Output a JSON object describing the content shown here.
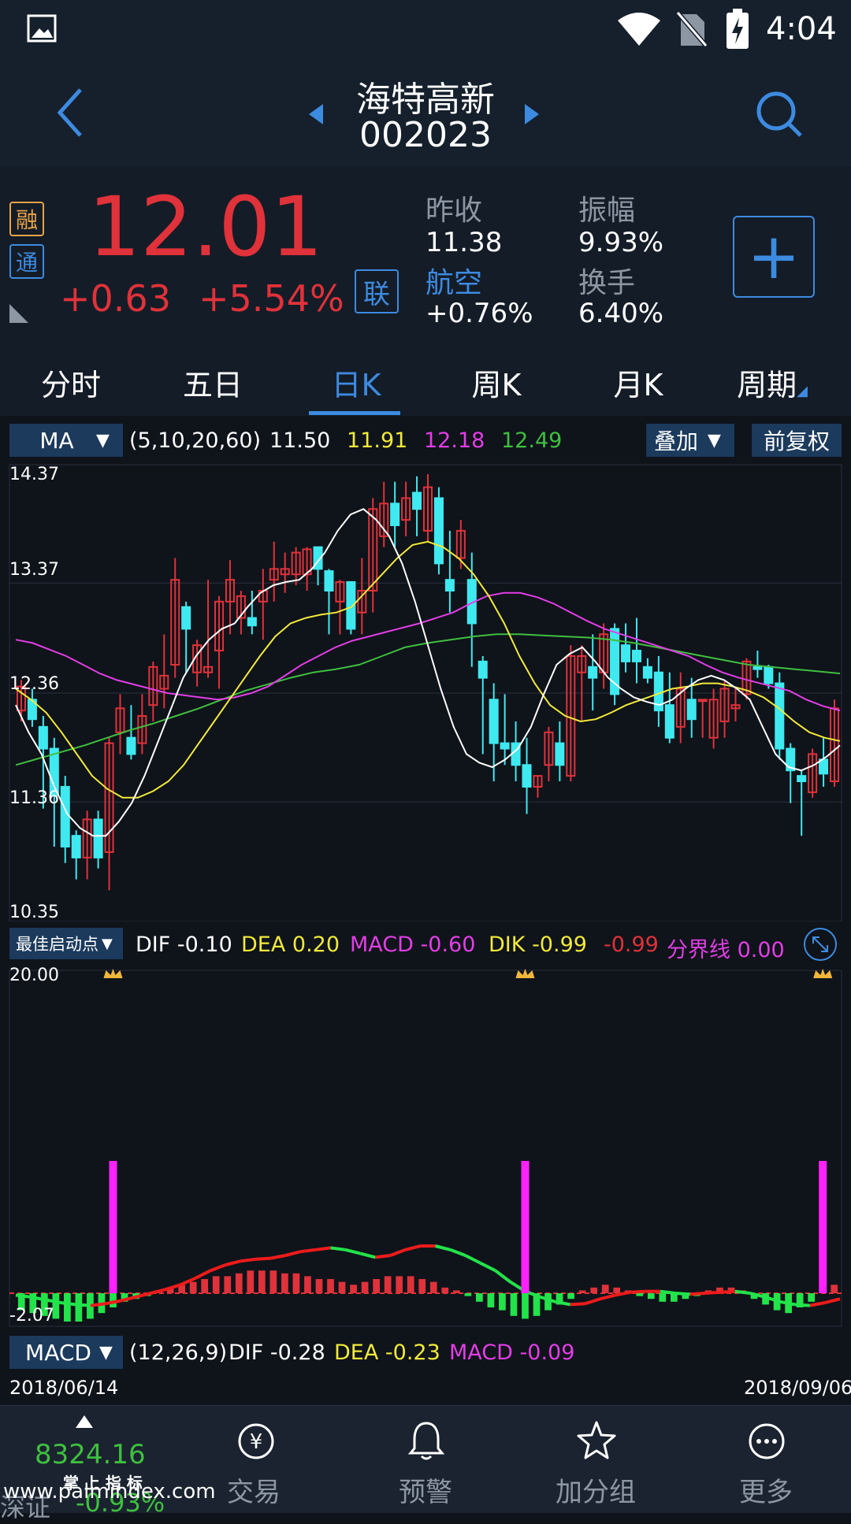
{
  "status": {
    "time": "4:04"
  },
  "header": {
    "name": "海特高新",
    "code": "002023"
  },
  "quote": {
    "badges": [
      "融",
      "通"
    ],
    "price": "12.01",
    "change": "+0.63",
    "change_pct": "+5.54%",
    "lian": "联",
    "prev_close_label": "昨收",
    "prev_close": "11.38",
    "amplitude_label": "振幅",
    "amplitude": "9.93%",
    "sector_label": "航空",
    "sector_change": "+0.76%",
    "turnover_label": "换手",
    "turnover": "6.40%",
    "plus": "+"
  },
  "tabs": [
    "分时",
    "五日",
    "日K",
    "周K",
    "月K",
    "周期"
  ],
  "active_tab": 2,
  "ma_bar": {
    "selector": "MA",
    "params": "(5,10,20,60)",
    "ma5": "11.50",
    "ma10": "11.91",
    "ma20": "12.18",
    "ma60": "12.49",
    "overlay": "叠加",
    "adjust": "前复权"
  },
  "price_axis": [
    "14.37",
    "13.37",
    "12.36",
    "11.36",
    "10.35"
  ],
  "ind_bar": {
    "selector": "最佳启动点",
    "dif_label": "DIF",
    "dif": "-0.10",
    "dea_label": "DEA",
    "dea": "0.20",
    "macd_label": "MACD",
    "macd": "-0.60",
    "dik_label": "DIK",
    "dik": "-0.99",
    "extra": "-0.99",
    "boundary_label": "分界线",
    "boundary": "0.00"
  },
  "ind_axis": {
    "top": "20.00",
    "bottom": "-2.07"
  },
  "macd_bar": {
    "selector": "MACD",
    "params": "(12,26,9)",
    "dif_label": "DIF",
    "dif": "-0.28",
    "dea_label": "DEA",
    "dea": "-0.23",
    "macd_label": "MACD",
    "macd": "-0.09"
  },
  "dates": {
    "start": "2018/06/14",
    "end": "2018/09/06"
  },
  "nav": {
    "index_value": "8324.16",
    "index_tag": "掌 上 指 标",
    "index_name": "深证",
    "index_change": "-0.93%",
    "items": [
      "交易",
      "预警",
      "加分组",
      "更多"
    ]
  },
  "watermark": "www.palmindex.com",
  "colors": {
    "up": "#e0323a",
    "down": "#3fe9f0",
    "ma5": "#ffffff",
    "ma10": "#f2ea3a",
    "ma20": "#e23ee6",
    "ma60": "#3fbf3f",
    "accent": "#3d8be0"
  },
  "chart_data": {
    "type": "candlestick",
    "ylim": [
      10.35,
      14.37
    ],
    "candles": [
      [
        12.2,
        12.42,
        12.1,
        12.48
      ],
      [
        12.3,
        12.12,
        12.05,
        12.4
      ],
      [
        12.05,
        11.85,
        11.3,
        12.15
      ],
      [
        11.85,
        11.42,
        10.95,
        11.95
      ],
      [
        11.5,
        10.95,
        10.8,
        11.6
      ],
      [
        11.05,
        10.85,
        10.65,
        11.1
      ],
      [
        10.85,
        11.2,
        10.65,
        11.28
      ],
      [
        11.2,
        10.85,
        10.75,
        11.28
      ],
      [
        10.9,
        11.9,
        10.55,
        11.95
      ],
      [
        12.0,
        12.22,
        11.8,
        12.35
      ],
      [
        11.95,
        11.8,
        11.75,
        12.25
      ],
      [
        11.9,
        12.15,
        11.8,
        12.35
      ],
      [
        12.25,
        12.6,
        12.1,
        12.65
      ],
      [
        12.4,
        12.52,
        12.22,
        12.9
      ],
      [
        12.62,
        13.4,
        12.5,
        13.6
      ],
      [
        13.15,
        12.95,
        12.55,
        13.2
      ],
      [
        12.55,
        12.8,
        12.42,
        12.85
      ],
      [
        12.55,
        12.6,
        12.5,
        13.4
      ],
      [
        12.75,
        13.2,
        12.4,
        13.25
      ],
      [
        13.2,
        13.4,
        12.9,
        13.58
      ],
      [
        13.05,
        13.25,
        12.9,
        13.3
      ],
      [
        13.05,
        12.98,
        12.9,
        13.3
      ],
      [
        13.2,
        13.3,
        12.85,
        13.5
      ],
      [
        13.4,
        13.5,
        13.2,
        13.75
      ],
      [
        13.45,
        13.5,
        13.28,
        13.65
      ],
      [
        13.45,
        13.65,
        13.35,
        13.7
      ],
      [
        13.45,
        13.68,
        13.3,
        13.7
      ],
      [
        13.7,
        13.5,
        13.35,
        13.7
      ],
      [
        13.48,
        13.3,
        12.9,
        13.5
      ],
      [
        13.2,
        13.38,
        12.9,
        13.4
      ],
      [
        13.38,
        12.95,
        12.9,
        13.38
      ],
      [
        13.1,
        13.3,
        12.9,
        13.6
      ],
      [
        13.3,
        14.05,
        13.1,
        14.15
      ],
      [
        13.8,
        14.1,
        13.7,
        14.3
      ],
      [
        14.1,
        13.9,
        13.7,
        14.3
      ],
      [
        13.95,
        14.15,
        13.8,
        14.3
      ],
      [
        14.2,
        14.05,
        13.8,
        14.35
      ],
      [
        13.85,
        14.25,
        13.75,
        14.37
      ],
      [
        14.15,
        13.55,
        13.45,
        14.25
      ],
      [
        13.4,
        13.3,
        13.1,
        13.85
      ],
      [
        13.6,
        13.85,
        13.5,
        13.95
      ],
      [
        13.4,
        13.0,
        12.6,
        13.65
      ],
      [
        12.65,
        12.5,
        11.8,
        12.7
      ],
      [
        12.3,
        11.9,
        11.55,
        12.45
      ],
      [
        11.9,
        11.85,
        11.7,
        12.35
      ],
      [
        11.9,
        11.7,
        11.55,
        12.1
      ],
      [
        11.7,
        11.5,
        11.25,
        11.95
      ],
      [
        11.5,
        11.6,
        11.4,
        11.6
      ],
      [
        11.7,
        12.0,
        11.55,
        12.05
      ],
      [
        11.9,
        11.7,
        11.55,
        12.1
      ],
      [
        11.6,
        12.7,
        11.55,
        12.8
      ],
      [
        12.55,
        12.7,
        12.1,
        12.8
      ],
      [
        12.6,
        12.5,
        12.2,
        12.9
      ],
      [
        12.55,
        12.9,
        12.4,
        13.0
      ],
      [
        12.95,
        12.35,
        12.25,
        13.0
      ],
      [
        12.8,
        12.65,
        12.55,
        13.0
      ],
      [
        12.75,
        12.65,
        12.45,
        13.05
      ],
      [
        12.6,
        12.5,
        12.45,
        12.68
      ],
      [
        12.55,
        12.2,
        12.05,
        12.7
      ],
      [
        12.25,
        11.95,
        11.9,
        12.55
      ],
      [
        12.05,
        12.4,
        11.9,
        12.55
      ],
      [
        12.3,
        12.12,
        11.95,
        12.5
      ],
      [
        12.3,
        12.3,
        11.95,
        12.3
      ],
      [
        11.95,
        12.3,
        11.85,
        12.4
      ],
      [
        12.1,
        12.4,
        11.95,
        12.48
      ],
      [
        12.22,
        12.25,
        12.1,
        12.4
      ],
      [
        12.35,
        12.65,
        12.3,
        12.68
      ],
      [
        12.6,
        12.58,
        12.5,
        12.75
      ],
      [
        12.6,
        12.45,
        12.4,
        12.62
      ],
      [
        12.45,
        11.85,
        11.75,
        12.55
      ],
      [
        11.85,
        11.65,
        11.35,
        11.9
      ],
      [
        11.6,
        11.55,
        11.05,
        11.65
      ],
      [
        11.45,
        11.8,
        11.4,
        11.85
      ],
      [
        11.75,
        11.62,
        11.5,
        11.95
      ],
      [
        11.55,
        12.22,
        11.5,
        12.3
      ]
    ],
    "ma_series": {
      "ma5": [
        12.25,
        12.0,
        11.8,
        11.5,
        11.25,
        11.12,
        11.05,
        11.05,
        11.18,
        11.35,
        11.6,
        11.9,
        12.2,
        12.5,
        12.7,
        12.85,
        12.95,
        13.0,
        13.15,
        13.28,
        13.35,
        13.38,
        13.4,
        13.5,
        13.65,
        13.85,
        14.0,
        14.05,
        13.95,
        13.8,
        13.55,
        13.2,
        12.8,
        12.4,
        12.05,
        11.8,
        11.72,
        11.68,
        11.75,
        11.85,
        12.05,
        12.35,
        12.62,
        12.72,
        12.78,
        12.65,
        12.5,
        12.4,
        12.32,
        12.28,
        12.25,
        12.3,
        12.4,
        12.48,
        12.52,
        12.48,
        12.4,
        12.3,
        12.05,
        11.8,
        11.68,
        11.65,
        11.7,
        11.78,
        11.88
      ],
      "ma10": [
        12.4,
        12.3,
        12.18,
        12.0,
        11.8,
        11.6,
        11.48,
        11.4,
        11.4,
        11.46,
        11.55,
        11.7,
        11.9,
        12.1,
        12.3,
        12.5,
        12.7,
        12.88,
        13.0,
        13.05,
        13.08,
        13.1,
        13.15,
        13.3,
        13.45,
        13.6,
        13.72,
        13.75,
        13.7,
        13.6,
        13.45,
        13.25,
        13.0,
        12.7,
        12.45,
        12.25,
        12.15,
        12.1,
        12.12,
        12.18,
        12.25,
        12.3,
        12.35,
        12.4,
        12.42,
        12.45,
        12.45,
        12.42,
        12.38,
        12.32,
        12.22,
        12.1,
        12.0,
        11.95,
        11.92
      ],
      "ma20": [
        12.85,
        12.82,
        12.76,
        12.7,
        12.62,
        12.54,
        12.48,
        12.44,
        12.4,
        12.36,
        12.34,
        12.32,
        12.3,
        12.32,
        12.36,
        12.42,
        12.52,
        12.62,
        12.7,
        12.78,
        12.84,
        12.88,
        12.92,
        12.96,
        13.0,
        13.05,
        13.1,
        13.18,
        13.25,
        13.28,
        13.28,
        13.24,
        13.18,
        13.1,
        13.02,
        12.95,
        12.9,
        12.85,
        12.8,
        12.75,
        12.7,
        12.62,
        12.55,
        12.5,
        12.46,
        12.42,
        12.38,
        12.3,
        12.24,
        12.2
      ],
      "ma60": [
        11.7,
        11.76,
        11.82,
        11.88,
        11.95,
        12.02,
        12.08,
        12.15,
        12.22,
        12.3,
        12.38,
        12.44,
        12.5,
        12.55,
        12.58,
        12.62,
        12.7,
        12.78,
        12.82,
        12.85,
        12.88,
        12.9,
        12.9,
        12.89,
        12.88,
        12.87,
        12.85,
        12.82,
        12.78,
        12.74,
        12.7,
        12.66,
        12.62,
        12.6,
        12.58,
        12.56,
        12.54
      ]
    },
    "signals": [
      8,
      44,
      70
    ],
    "macd_hist": [
      -0.6,
      -0.7,
      -0.8,
      -0.9,
      -1.0,
      -1.0,
      -0.9,
      -0.7,
      -0.5,
      -0.3,
      -0.2,
      -0.1,
      0.1,
      0.2,
      0.3,
      0.4,
      0.5,
      0.6,
      0.6,
      0.7,
      0.8,
      0.8,
      0.8,
      0.7,
      0.7,
      0.6,
      0.5,
      0.5,
      0.4,
      0.3,
      0.4,
      0.5,
      0.6,
      0.6,
      0.6,
      0.5,
      0.4,
      0.2,
      0.1,
      -0.1,
      -0.3,
      -0.5,
      -0.6,
      -0.8,
      -0.9,
      -0.8,
      -0.6,
      -0.4,
      -0.2,
      0.1,
      0.2,
      0.3,
      0.2,
      0.1,
      -0.1,
      -0.2,
      -0.3,
      -0.3,
      -0.2,
      -0.1,
      0.1,
      0.2,
      0.2,
      0.1,
      -0.2,
      -0.4,
      -0.6,
      -0.7,
      -0.5,
      -0.3,
      0.1,
      0.3
    ],
    "dif_line": [
      -0.1,
      -0.2,
      -0.35,
      -0.5,
      -0.6,
      -0.65,
      -0.55,
      -0.4,
      -0.2,
      0.0,
      0.2,
      0.45,
      0.8,
      1.2,
      1.5,
      1.7,
      1.8,
      1.85,
      2.0,
      2.2,
      2.3,
      2.4,
      2.3,
      2.1,
      1.9,
      2.0,
      2.3,
      2.5,
      2.5,
      2.3,
      2.0,
      1.6,
      1.2,
      0.6,
      0.1,
      -0.2,
      -0.45,
      -0.6,
      -0.55,
      -0.3,
      -0.1,
      0.05,
      0.1,
      0.1,
      0.0,
      -0.05,
      0.0,
      0.05,
      0.1,
      0.0,
      -0.2,
      -0.45,
      -0.6,
      -0.65,
      -0.5,
      -0.3
    ]
  }
}
